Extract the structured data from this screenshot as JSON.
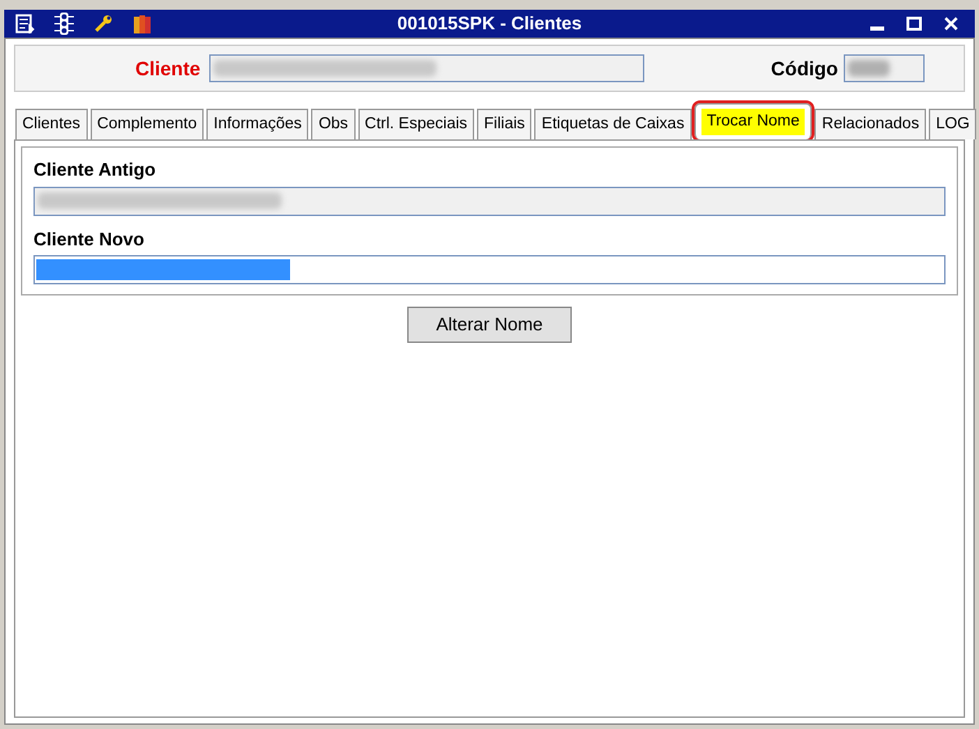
{
  "window": {
    "title": "001015SPK - Clientes"
  },
  "header": {
    "cliente_label": "Cliente",
    "codigo_label": "Código"
  },
  "tabs": [
    {
      "label": "Clientes",
      "selected": false,
      "highlighted": false
    },
    {
      "label": "Complemento",
      "selected": false,
      "highlighted": false
    },
    {
      "label": "Informações",
      "selected": false,
      "highlighted": false
    },
    {
      "label": "Obs",
      "selected": false,
      "highlighted": false
    },
    {
      "label": "Ctrl. Especiais",
      "selected": false,
      "highlighted": false
    },
    {
      "label": "Filiais",
      "selected": false,
      "highlighted": false
    },
    {
      "label": "Etiquetas de Caixas",
      "selected": false,
      "highlighted": false
    },
    {
      "label": "Trocar Nome",
      "selected": true,
      "highlighted": true
    },
    {
      "label": "Relacionados",
      "selected": false,
      "highlighted": false
    },
    {
      "label": "LOG",
      "selected": false,
      "highlighted": false
    }
  ],
  "form": {
    "old_label": "Cliente Antigo",
    "new_label": "Cliente Novo",
    "button": "Alterar Nome"
  }
}
